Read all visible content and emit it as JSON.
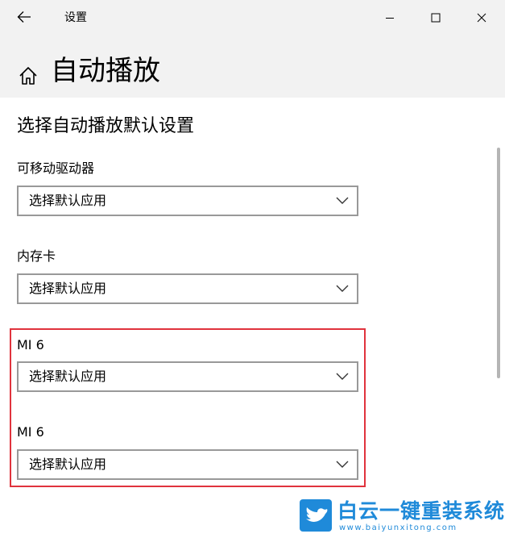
{
  "window": {
    "title": "设置",
    "controls": {
      "back": "back-arrow-icon",
      "minimize": "minimize-icon",
      "maximize": "maximize-icon",
      "close": "close-icon"
    }
  },
  "header": {
    "home_icon": "home-icon",
    "page_title": "自动播放"
  },
  "content": {
    "section_title": "选择自动播放默认设置",
    "devices": [
      {
        "label": "可移动驱动器",
        "selected": "选择默认应用"
      },
      {
        "label": "内存卡",
        "selected": "选择默认应用"
      },
      {
        "label": "MI 6",
        "selected": "选择默认应用"
      },
      {
        "label": "MI 6",
        "selected": "选择默认应用"
      }
    ]
  },
  "watermark": {
    "brand": "白云一键重装系统",
    "url": "www.baiyunxitong.com"
  },
  "colors": {
    "chrome_bg": "#f2f2f2",
    "content_bg": "#ffffff",
    "dropdown_border": "#999999",
    "highlight_border": "#e0333d",
    "watermark": "#1f8ad9"
  }
}
